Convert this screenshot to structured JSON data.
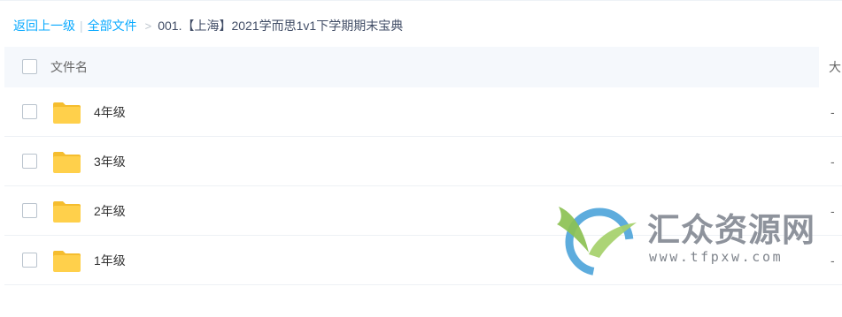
{
  "breadcrumb": {
    "back": "返回上一级",
    "separator": "|",
    "all_files": "全部文件",
    "arrow": ">",
    "current": "001.【上海】2021学而思1v1下学期期末宝典"
  },
  "table": {
    "columns": {
      "name": "文件名",
      "size": "大"
    },
    "rows": [
      {
        "name": "4年级",
        "size": "-",
        "icon": "folder-icon"
      },
      {
        "name": "3年级",
        "size": "-",
        "icon": "folder-icon"
      },
      {
        "name": "2年级",
        "size": "-",
        "icon": "folder-icon"
      },
      {
        "name": "1年级",
        "size": "-",
        "icon": "folder-icon"
      }
    ]
  },
  "watermark": {
    "title": "汇众资源网",
    "url": "www.tfpxw.com"
  },
  "colors": {
    "link": "#09aaff",
    "header_bg": "#f5f8fc",
    "folder": "#ffd04b",
    "folder_tab": "#f5bd2e",
    "watermark_green": "#8cc152",
    "watermark_blue": "#4ba3d9"
  }
}
